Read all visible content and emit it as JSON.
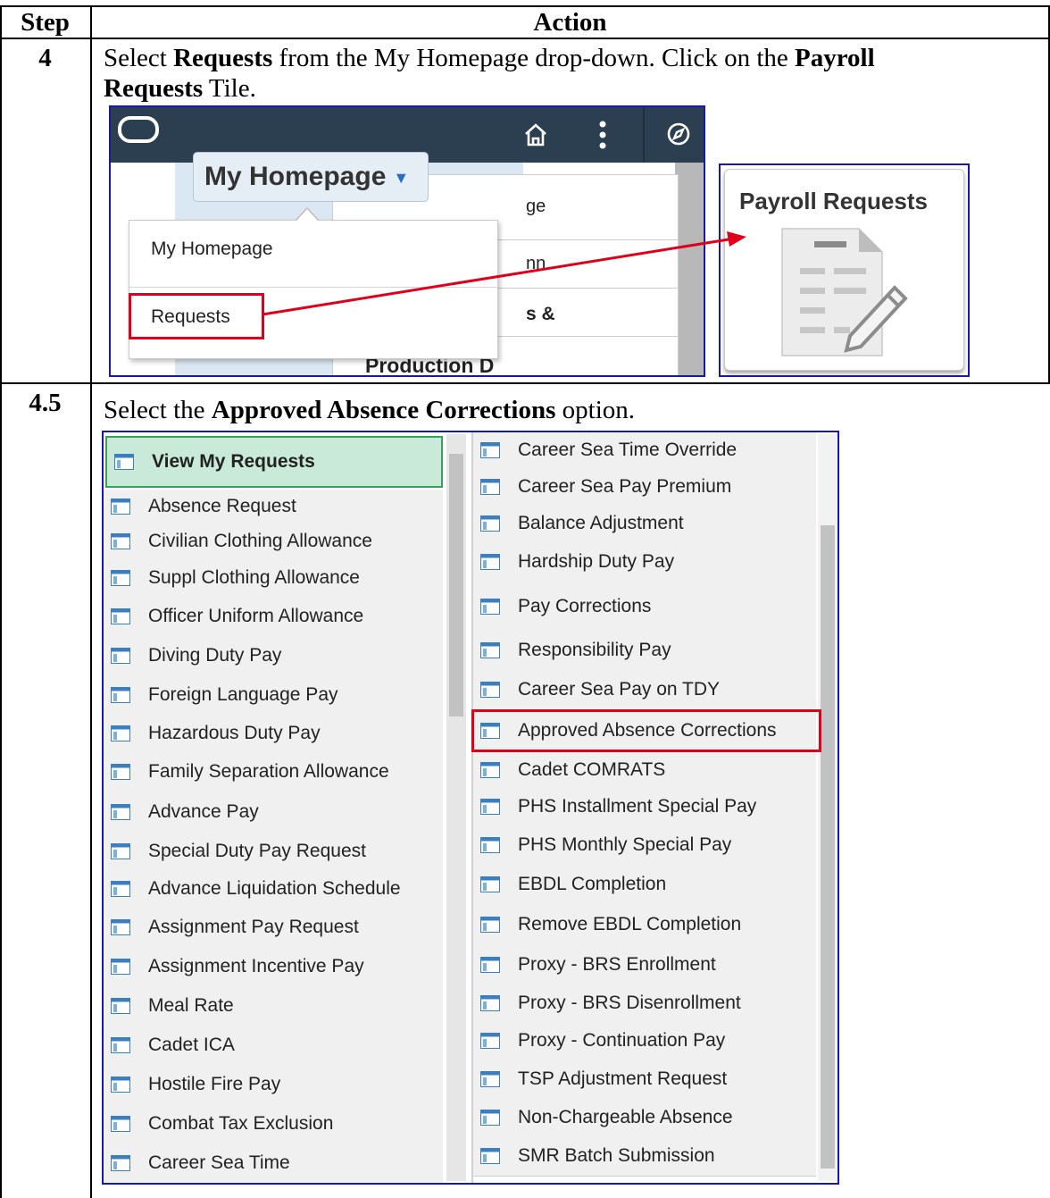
{
  "table": {
    "header_step": "Step",
    "header_action": "Action"
  },
  "step4": {
    "number": "4",
    "instr_parts": [
      "Select ",
      "Requests",
      " from the My Homepage drop-down. Click on the ",
      "Payroll"
    ],
    "instr_line2_parts": [
      "Requests",
      " Tile."
    ],
    "screenshot": {
      "homepage_button": "My Homepage",
      "menu_items": [
        "My Homepage",
        "Requests"
      ],
      "background_fragments": [
        "ge",
        "nn",
        "s &",
        "Production D"
      ],
      "tile_title": "Payroll Requests"
    }
  },
  "step45": {
    "number": "4.5",
    "instr_parts": [
      "Select the ",
      "Approved Absence Corrections",
      " option."
    ],
    "left_items": [
      "View My Requests",
      "Absence Request",
      "Civilian Clothing Allowance",
      "Suppl Clothing Allowance",
      "Officer Uniform Allowance",
      "Diving Duty Pay",
      "Foreign Language Pay",
      "Hazardous Duty Pay",
      "Family Separation Allowance",
      "Advance Pay",
      "Special Duty Pay Request",
      "Advance Liquidation Schedule",
      "Assignment Pay Request",
      "Assignment Incentive Pay",
      "Meal Rate",
      "Cadet ICA",
      "Hostile Fire Pay",
      "Combat Tax Exclusion",
      "Career Sea Time"
    ],
    "right_items": [
      "Career Sea Time Override",
      "Career Sea Pay Premium",
      "Balance Adjustment",
      "Hardship Duty Pay",
      "Pay Corrections",
      "Responsibility Pay",
      "Career Sea Pay on TDY",
      "Approved Absence Corrections",
      "Cadet COMRATS",
      "PHS Installment Special Pay",
      "PHS Monthly Special Pay",
      "EBDL Completion",
      "Remove EBDL Completion",
      "Proxy - BRS Enrollment",
      "Proxy - BRS Disenrollment",
      "Proxy - Continuation Pay",
      "TSP Adjustment Request",
      "Non-Chargeable Absence",
      "SMR Batch Submission"
    ]
  },
  "icons": {
    "list_item": "page-icon",
    "topbar": [
      "oracle-logo-icon",
      "home-icon",
      "more-actions-icon",
      "navigator-icon"
    ],
    "tile": "document-edit-icon"
  },
  "colors": {
    "highlight_box": "#e0001b",
    "selected_row": "#c9ead8",
    "topbar": "#2b3f50"
  }
}
